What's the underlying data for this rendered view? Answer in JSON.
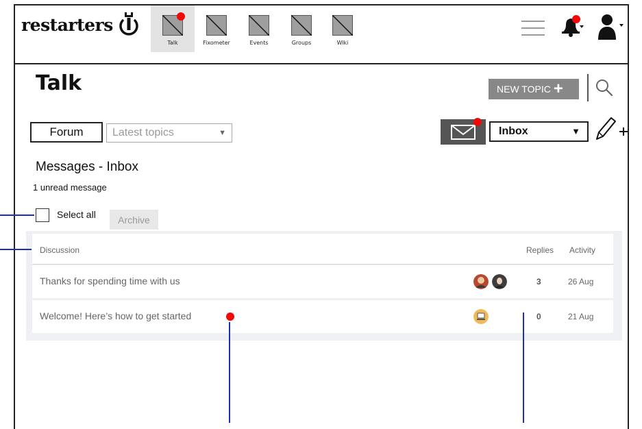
{
  "brand": {
    "name": "restarters"
  },
  "nav": [
    {
      "label": "Talk",
      "active": true,
      "has_dot": true
    },
    {
      "label": "Fixometer",
      "active": false,
      "has_dot": false
    },
    {
      "label": "Events",
      "active": false,
      "has_dot": false
    },
    {
      "label": "Groups",
      "active": false,
      "has_dot": false
    },
    {
      "label": "Wiki",
      "active": false,
      "has_dot": false
    }
  ],
  "header_icons": {
    "menu": "hamburger-menu-icon",
    "notifications": "bell-icon",
    "account": "user-icon"
  },
  "page": {
    "title": "Talk"
  },
  "toolbar": {
    "new_topic_label": "NEW TOPIC",
    "search_icon": "search-icon",
    "forum_label": "Forum",
    "latest_topics_label": "Latest topics",
    "inbox_label": "Inbox",
    "mail_icon": "envelope-icon",
    "compose_icon": "pencil-plus-icon"
  },
  "messages": {
    "heading": "Messages - Inbox",
    "unread_text": "1 unread message",
    "select_all_label": "Select all",
    "archive_label": "Archive"
  },
  "table": {
    "columns": {
      "discussion": "Discussion",
      "replies": "Replies",
      "activity": "Activity"
    },
    "rows": [
      {
        "title": "Thanks for spending time with us",
        "replies": "3",
        "activity": "26 Aug",
        "unread": false
      },
      {
        "title": "Welcome! Here’s how to get started",
        "replies": "0",
        "activity": "21 Aug",
        "unread": true
      }
    ]
  },
  "colors": {
    "accent_dot": "#ef0a0a",
    "callout_line": "#1a2fb8",
    "button_grey": "#888888",
    "mail_bg": "#555555"
  }
}
